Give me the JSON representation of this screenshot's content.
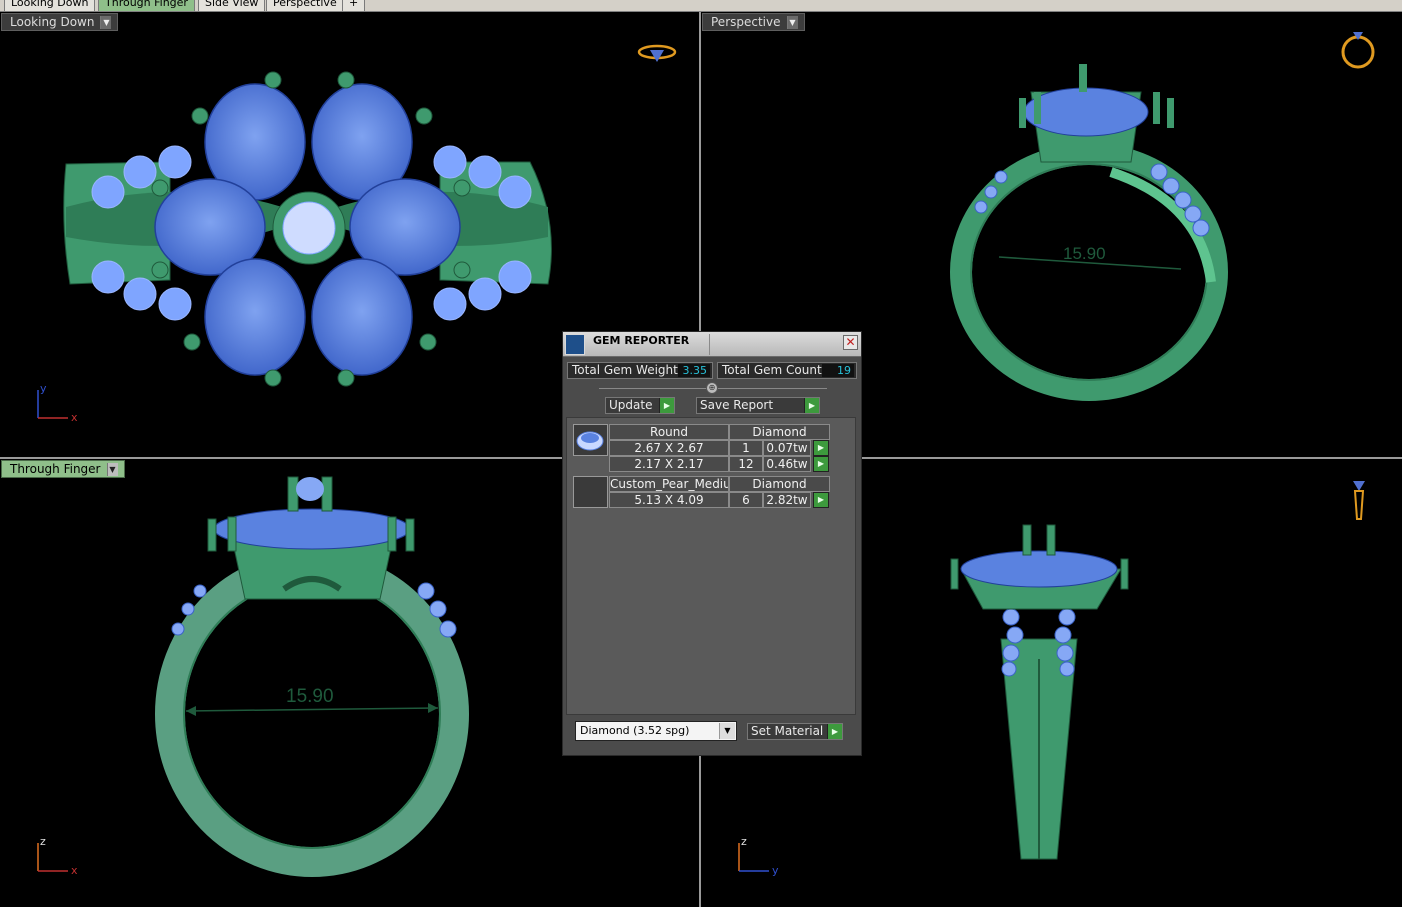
{
  "tabs": [
    {
      "label": "Looking Down"
    },
    {
      "label": "Through Finger"
    },
    {
      "label": "Side View"
    },
    {
      "label": "Perspective"
    },
    {
      "label": "+"
    }
  ],
  "viewports": {
    "top_left": {
      "label": "Looking Down",
      "axis_a": "y",
      "axis_b": "x"
    },
    "top_right": {
      "label": "Perspective",
      "dimension": "15.90"
    },
    "bottom_left": {
      "label": "Through Finger",
      "dimension": "15.90",
      "axis_a": "z",
      "axis_b": "x"
    },
    "bottom_right": {
      "label": "",
      "axis_a": "z",
      "axis_b": "y"
    }
  },
  "gem_reporter": {
    "title": "GEM REPORTER",
    "total_weight_label": "Total Gem Weight",
    "total_weight_value": "3.35",
    "total_count_label": "Total Gem Count",
    "total_count_value": "19",
    "update_label": "Update",
    "save_report_label": "Save Report",
    "groups": [
      {
        "shape": "Round",
        "material": "Diamond",
        "rows": [
          {
            "size": "2.67 X 2.67",
            "count": "1",
            "weight": "0.07tw"
          },
          {
            "size": "2.17 X 2.17",
            "count": "12",
            "weight": "0.46tw"
          }
        ]
      },
      {
        "shape": "Custom_Pear_Medium",
        "material": "Diamond",
        "rows": [
          {
            "size": "5.13 X 4.09",
            "count": "6",
            "weight": "2.82tw"
          }
        ]
      }
    ],
    "material_select": "Diamond     (3.52 spg)",
    "set_material_label": "Set Material"
  },
  "colors": {
    "metal": "#3f9a6e",
    "metal_light": "#5ec48f",
    "gem": "#5a82e0",
    "gem_light": "#a9c3ff",
    "active_tab": "#8fbf8a",
    "go_button": "#3d9a3d",
    "value_text": "#28c0d8"
  },
  "icons": {
    "close": "close-icon",
    "go": "play-arrow-icon",
    "ring_top": "ring-top-view-icon",
    "ring_front": "ring-front-view-icon",
    "ring_side": "ring-side-view-icon"
  }
}
